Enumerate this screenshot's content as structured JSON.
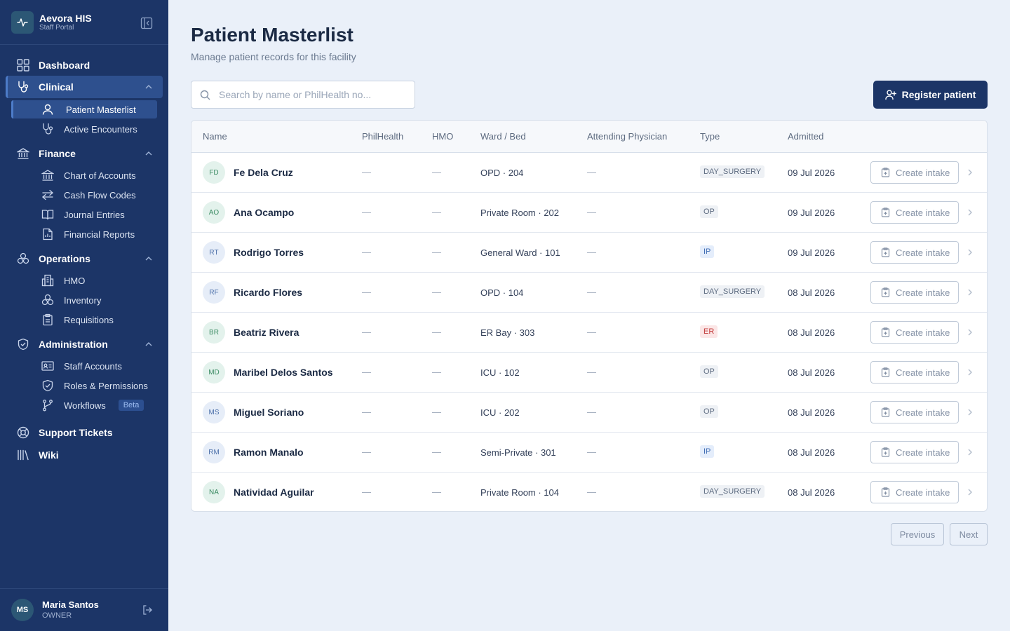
{
  "app": {
    "name": "Aevora HIS",
    "subtitle": "Staff Portal"
  },
  "sidebar": {
    "dashboard": "Dashboard",
    "clinical": {
      "label": "Clinical",
      "items": [
        "Patient Masterlist",
        "Active Encounters"
      ]
    },
    "finance": {
      "label": "Finance",
      "items": [
        "Chart of Accounts",
        "Cash Flow Codes",
        "Journal Entries",
        "Financial Reports"
      ]
    },
    "operations": {
      "label": "Operations",
      "items": [
        "HMO",
        "Inventory",
        "Requisitions"
      ]
    },
    "administration": {
      "label": "Administration",
      "items": [
        "Staff Accounts",
        "Roles & Permissions",
        "Workflows"
      ],
      "beta_label": "Beta"
    },
    "support": "Support Tickets",
    "wiki": "Wiki"
  },
  "user": {
    "initials": "MS",
    "name": "Maria Santos",
    "role": "OWNER"
  },
  "page": {
    "title": "Patient Masterlist",
    "subtitle": "Manage patient records for this facility"
  },
  "search": {
    "placeholder": "Search by name or PhilHealth no..."
  },
  "register_label": "Register patient",
  "table": {
    "columns": [
      "Name",
      "PhilHealth",
      "HMO",
      "Ward / Bed",
      "Attending Physician",
      "Type",
      "Admitted"
    ],
    "empty": "—",
    "intake_label": "Create intake",
    "rows": [
      {
        "initials": "FD",
        "name": "Fe Dela Cruz",
        "ward": "OPD · 204",
        "type": "DAY_SURGERY",
        "admitted": "09 Jul 2026"
      },
      {
        "initials": "AO",
        "name": "Ana Ocampo",
        "ward": "Private Room · 202",
        "type": "OP",
        "admitted": "09 Jul 2026"
      },
      {
        "initials": "RT",
        "name": "Rodrigo Torres",
        "ward": "General Ward · 101",
        "type": "IP",
        "admitted": "09 Jul 2026"
      },
      {
        "initials": "RF",
        "name": "Ricardo Flores",
        "ward": "OPD · 104",
        "type": "DAY_SURGERY",
        "admitted": "08 Jul 2026"
      },
      {
        "initials": "BR",
        "name": "Beatriz Rivera",
        "ward": "ER Bay · 303",
        "type": "ER",
        "admitted": "08 Jul 2026"
      },
      {
        "initials": "MD",
        "name": "Maribel Delos Santos",
        "ward": "ICU · 102",
        "type": "OP",
        "admitted": "08 Jul 2026"
      },
      {
        "initials": "MS",
        "name": "Miguel Soriano",
        "ward": "ICU · 202",
        "type": "OP",
        "admitted": "08 Jul 2026"
      },
      {
        "initials": "RM",
        "name": "Ramon Manalo",
        "ward": "Semi-Private · 301",
        "type": "IP",
        "admitted": "08 Jul 2026"
      },
      {
        "initials": "NA",
        "name": "Natividad Aguilar",
        "ward": "Private Room · 104",
        "type": "DAY_SURGERY",
        "admitted": "08 Jul 2026"
      }
    ]
  },
  "pagination": {
    "previous": "Previous",
    "next": "Next"
  },
  "colors": {
    "sidebar": "#1c3567",
    "accent": "#4d7cc9",
    "background": "#eaf0f9",
    "primary_button": "#1c3567"
  }
}
